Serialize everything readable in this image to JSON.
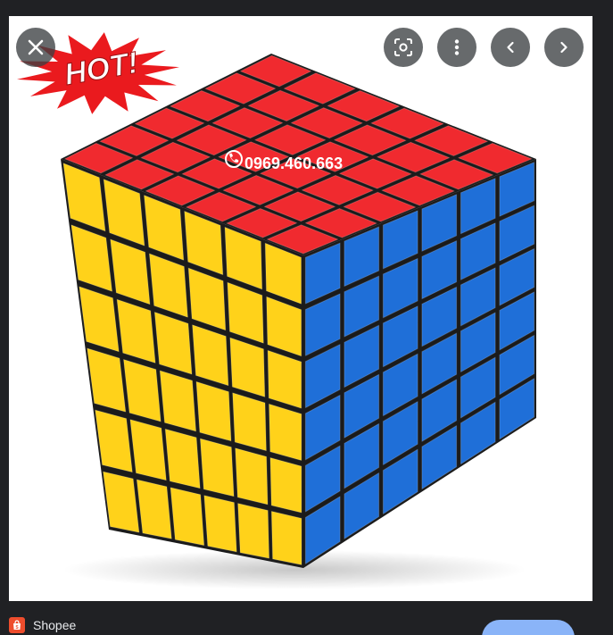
{
  "image": {
    "badge_text": "HOT!",
    "watermark_text": "0969.460.663",
    "colors": {
      "top_face": "#f02a2f",
      "left_face": "#ffd21a",
      "right_face": "#1f6fd8",
      "badge": "#ea1a1e"
    }
  },
  "controls": {
    "close": {
      "icon": "close-icon"
    },
    "lens": {
      "icon": "lens-search-icon"
    },
    "more": {
      "icon": "more-vertical-icon"
    },
    "prev": {
      "icon": "chevron-left-icon"
    },
    "next": {
      "icon": "chevron-right-icon"
    }
  },
  "source": {
    "name": "Shopee",
    "favicon": "shopee-bag-icon",
    "brand_color": "#ee4d2d"
  },
  "visit": {
    "label": "",
    "color": "#8ab4f8"
  }
}
